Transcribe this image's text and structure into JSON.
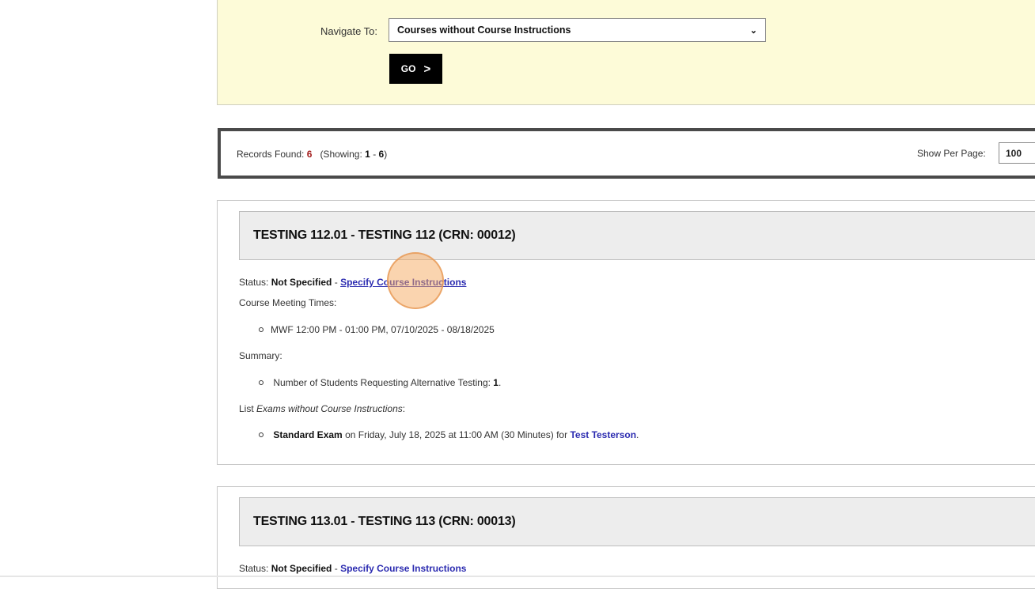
{
  "navigate": {
    "label": "Navigate To:",
    "selected": "Courses without Course Instructions",
    "go_label": "GO",
    "go_arrow": ">"
  },
  "records": {
    "prefix": "Records Found:",
    "count": "6",
    "showing_prefix": "(Showing:",
    "showing_from": "1",
    "showing_sep": "-",
    "showing_to": "6",
    "showing_suffix": ")",
    "per_page_label": "Show Per Page:",
    "per_page_value": "100"
  },
  "courses": [
    {
      "title": "TESTING 112.01 - TESTING 112 (CRN: 00012)",
      "status_label": "Status:",
      "status_value": "Not Specified",
      "status_sep": "-",
      "action_link": "Specify Course Instructions",
      "meeting_label": "Course Meeting Times:",
      "meeting_times": [
        "MWF 12:00 PM - 01:00 PM, 07/10/2025 - 08/18/2025"
      ],
      "summary_label": "Summary:",
      "summary_prefix": "Number of Students Requesting Alternative Testing:",
      "summary_count": "1",
      "list_prefix": "List",
      "list_italic": "Exams without Course Instructions",
      "list_suffix": ":",
      "exam_name": "Standard Exam",
      "exam_details": "on Friday, July 18, 2025 at 11:00 AM (30 Minutes) for",
      "exam_student": "Test Testerson"
    },
    {
      "title": "TESTING 113.01 - TESTING 113 (CRN: 00013)",
      "status_label": "Status:",
      "status_value": "Not Specified",
      "status_sep": "-",
      "action_link": "Specify Course Instructions"
    }
  ]
}
